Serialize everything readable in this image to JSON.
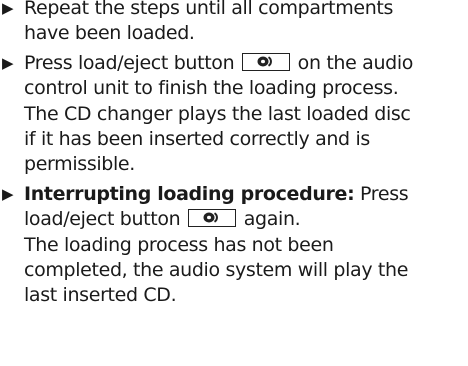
{
  "steps": [
    {
      "lines": [
        "Repeat the steps until all compartments",
        "have been loaded."
      ]
    },
    {
      "line1_before": "Press load/eject button",
      "line1_after": "on the audio",
      "lines": [
        "control unit to finish the loading process.",
        "The CD changer plays the last loaded disc",
        "if it has been inserted correctly and is",
        "permissible."
      ]
    },
    {
      "heading": "Interrupting loading procedure:",
      "heading_after": "Press",
      "line2_before": "load/eject button",
      "line2_after": "again.",
      "lines": [
        "The loading process has not been",
        "completed, the audio system will play the",
        "last inserted CD."
      ]
    }
  ],
  "icons": {
    "bullet": "triangle-right-icon",
    "button": "load-eject-button-icon"
  }
}
